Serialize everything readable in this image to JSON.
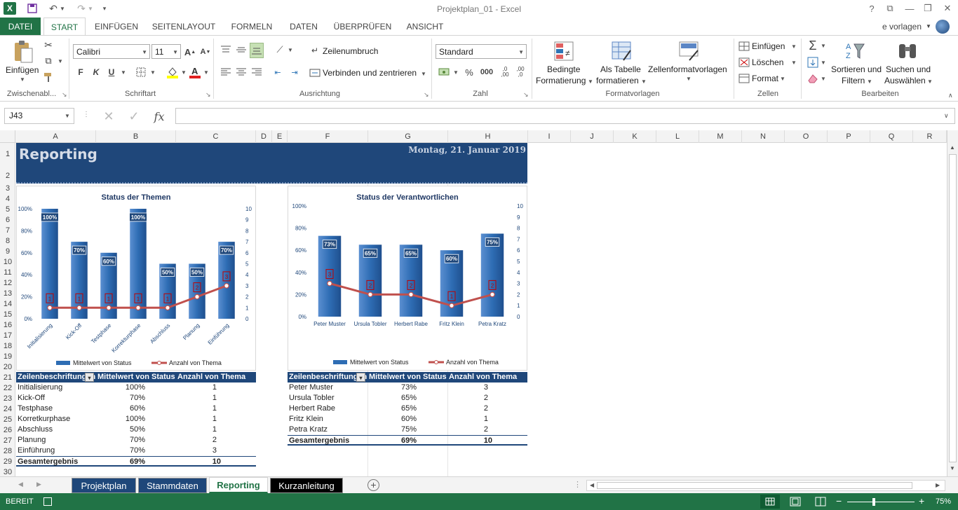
{
  "window": {
    "title": "Projektplan_01 - Excel",
    "help": "?",
    "user": "e vorlagen"
  },
  "tabs": [
    {
      "label": "DATEI"
    },
    {
      "label": "START"
    },
    {
      "label": "EINFÜGEN"
    },
    {
      "label": "SEITENLAYOUT"
    },
    {
      "label": "FORMELN"
    },
    {
      "label": "DATEN"
    },
    {
      "label": "ÜBERPRÜFEN"
    },
    {
      "label": "ANSICHT"
    }
  ],
  "ribbon": {
    "clipboard": {
      "paste": "Einfügen",
      "label": "Zwischenabl..."
    },
    "font": {
      "name": "Calibri",
      "size": "11",
      "bold": "F",
      "italic": "K",
      "underline": "U",
      "label": "Schriftart"
    },
    "alignment": {
      "wrap": "Zeilenumbruch",
      "merge": "Verbinden und zentrieren",
      "label": "Ausrichtung"
    },
    "number": {
      "format": "Standard",
      "percent": "%",
      "thousands": "000",
      "label": "Zahl"
    },
    "styles": {
      "conditional_1": "Bedingte",
      "conditional_2": "Formatierung",
      "table_1": "Als Tabelle",
      "table_2": "formatieren",
      "cell_styles": "Zellenformatvorlagen",
      "label": "Formatvorlagen"
    },
    "cells": {
      "insert": "Einfügen",
      "delete": "Löschen",
      "format": "Format",
      "label": "Zellen"
    },
    "editing": {
      "sort_1": "Sortieren und",
      "sort_2": "Filtern",
      "find_1": "Suchen und",
      "find_2": "Auswählen",
      "label": "Bearbeiten"
    }
  },
  "formula_bar": {
    "name_box": "J43",
    "fx": "fx",
    "value": ""
  },
  "columns": [
    "A",
    "B",
    "C",
    "D",
    "E",
    "F",
    "G",
    "H",
    "I",
    "J",
    "K",
    "L",
    "M",
    "N",
    "O",
    "P",
    "Q",
    "R"
  ],
  "rows": [
    "1",
    "2",
    "3",
    "4",
    "5",
    "6",
    "7",
    "8",
    "9",
    "10",
    "11",
    "12",
    "13",
    "14",
    "15",
    "16",
    "17",
    "18",
    "19",
    "20",
    "21",
    "22",
    "23",
    "24",
    "25",
    "26",
    "27",
    "28",
    "29",
    "30"
  ],
  "report": {
    "title": "Reporting",
    "date": "Montag, 21. Januar 2019"
  },
  "chart_data": [
    {
      "type": "bar",
      "title": "Status der Themen",
      "categories": [
        "Initialisierung",
        "Kick-Off",
        "Testphase",
        "Korrekturphase",
        "Abschluss",
        "Planung",
        "Einführung"
      ],
      "series": [
        {
          "name": "Mittelwert von Status",
          "type": "bar",
          "axis": "left",
          "values": [
            1.0,
            0.7,
            0.6,
            1.0,
            0.5,
            0.5,
            0.7
          ],
          "labels": [
            "100%",
            "70%",
            "60%",
            "100%",
            "50%",
            "50%",
            "70%"
          ]
        },
        {
          "name": "Anzahl von Thema",
          "type": "line",
          "axis": "right",
          "values": [
            1,
            1,
            1,
            1,
            1,
            2,
            3
          ]
        }
      ],
      "y_ticks": [
        "0%",
        "20%",
        "40%",
        "60%",
        "80%",
        "100%"
      ],
      "y2_ticks": [
        "0",
        "1",
        "2",
        "3",
        "4",
        "5",
        "6",
        "7",
        "8",
        "9",
        "10"
      ],
      "ylim": [
        0,
        1
      ],
      "y2lim": [
        0,
        10
      ],
      "legend": "bottom"
    },
    {
      "type": "bar",
      "title": "Status der Verantwortlichen",
      "categories": [
        "Peter Muster",
        "Ursula Tobler",
        "Herbert Rabe",
        "Fritz Klein",
        "Petra Kratz"
      ],
      "series": [
        {
          "name": "Mittelwert von Status",
          "type": "bar",
          "axis": "left",
          "values": [
            0.73,
            0.65,
            0.65,
            0.6,
            0.75
          ],
          "labels": [
            "73%",
            "65%",
            "65%",
            "60%",
            "75%"
          ]
        },
        {
          "name": "Anzahl von Thema",
          "type": "line",
          "axis": "right",
          "values": [
            3,
            2,
            2,
            1,
            2
          ]
        }
      ],
      "y_ticks": [
        "0%",
        "20%",
        "40%",
        "60%",
        "80%",
        "100%"
      ],
      "y2_ticks": [
        "0",
        "1",
        "2",
        "3",
        "4",
        "5",
        "6",
        "7",
        "8",
        "9",
        "10"
      ],
      "ylim": [
        0,
        1
      ],
      "y2lim": [
        0,
        10
      ],
      "legend": "bottom"
    }
  ],
  "pivot1": {
    "headers": [
      "Zeilenbeschriftungen",
      "Mittelwert von Status",
      "Anzahl von Thema"
    ],
    "rows": [
      [
        "Initialisierung",
        "100%",
        "1"
      ],
      [
        "Kick-Off",
        "70%",
        "1"
      ],
      [
        "Testphase",
        "60%",
        "1"
      ],
      [
        "Korretkurphase",
        "100%",
        "1"
      ],
      [
        "Abschluss",
        "50%",
        "1"
      ],
      [
        "Planung",
        "70%",
        "2"
      ],
      [
        "Einführung",
        "70%",
        "3"
      ]
    ],
    "total": [
      "Gesamtergebnis",
      "69%",
      "10"
    ]
  },
  "pivot2": {
    "headers": [
      "Zeilenbeschriftungen",
      "Mittelwert von Status",
      "Anzahl von Thema"
    ],
    "rows": [
      [
        "Peter Muster",
        "73%",
        "3"
      ],
      [
        "Ursula Tobler",
        "65%",
        "2"
      ],
      [
        "Herbert Rabe",
        "65%",
        "2"
      ],
      [
        "Fritz Klein",
        "60%",
        "1"
      ],
      [
        "Petra Kratz",
        "75%",
        "2"
      ]
    ],
    "total": [
      "Gesamtergebnis",
      "69%",
      "10"
    ]
  },
  "sheets": [
    {
      "label": "Projektplan"
    },
    {
      "label": "Stammdaten"
    },
    {
      "label": "Reporting"
    },
    {
      "label": "Kurzanleitung"
    }
  ],
  "status": {
    "mode": "BEREIT",
    "zoom": "75%"
  },
  "colors": {
    "excel_green": "#217346",
    "banner": "#1f477a",
    "bar": "#2e6db4",
    "line": "#c0504d"
  }
}
